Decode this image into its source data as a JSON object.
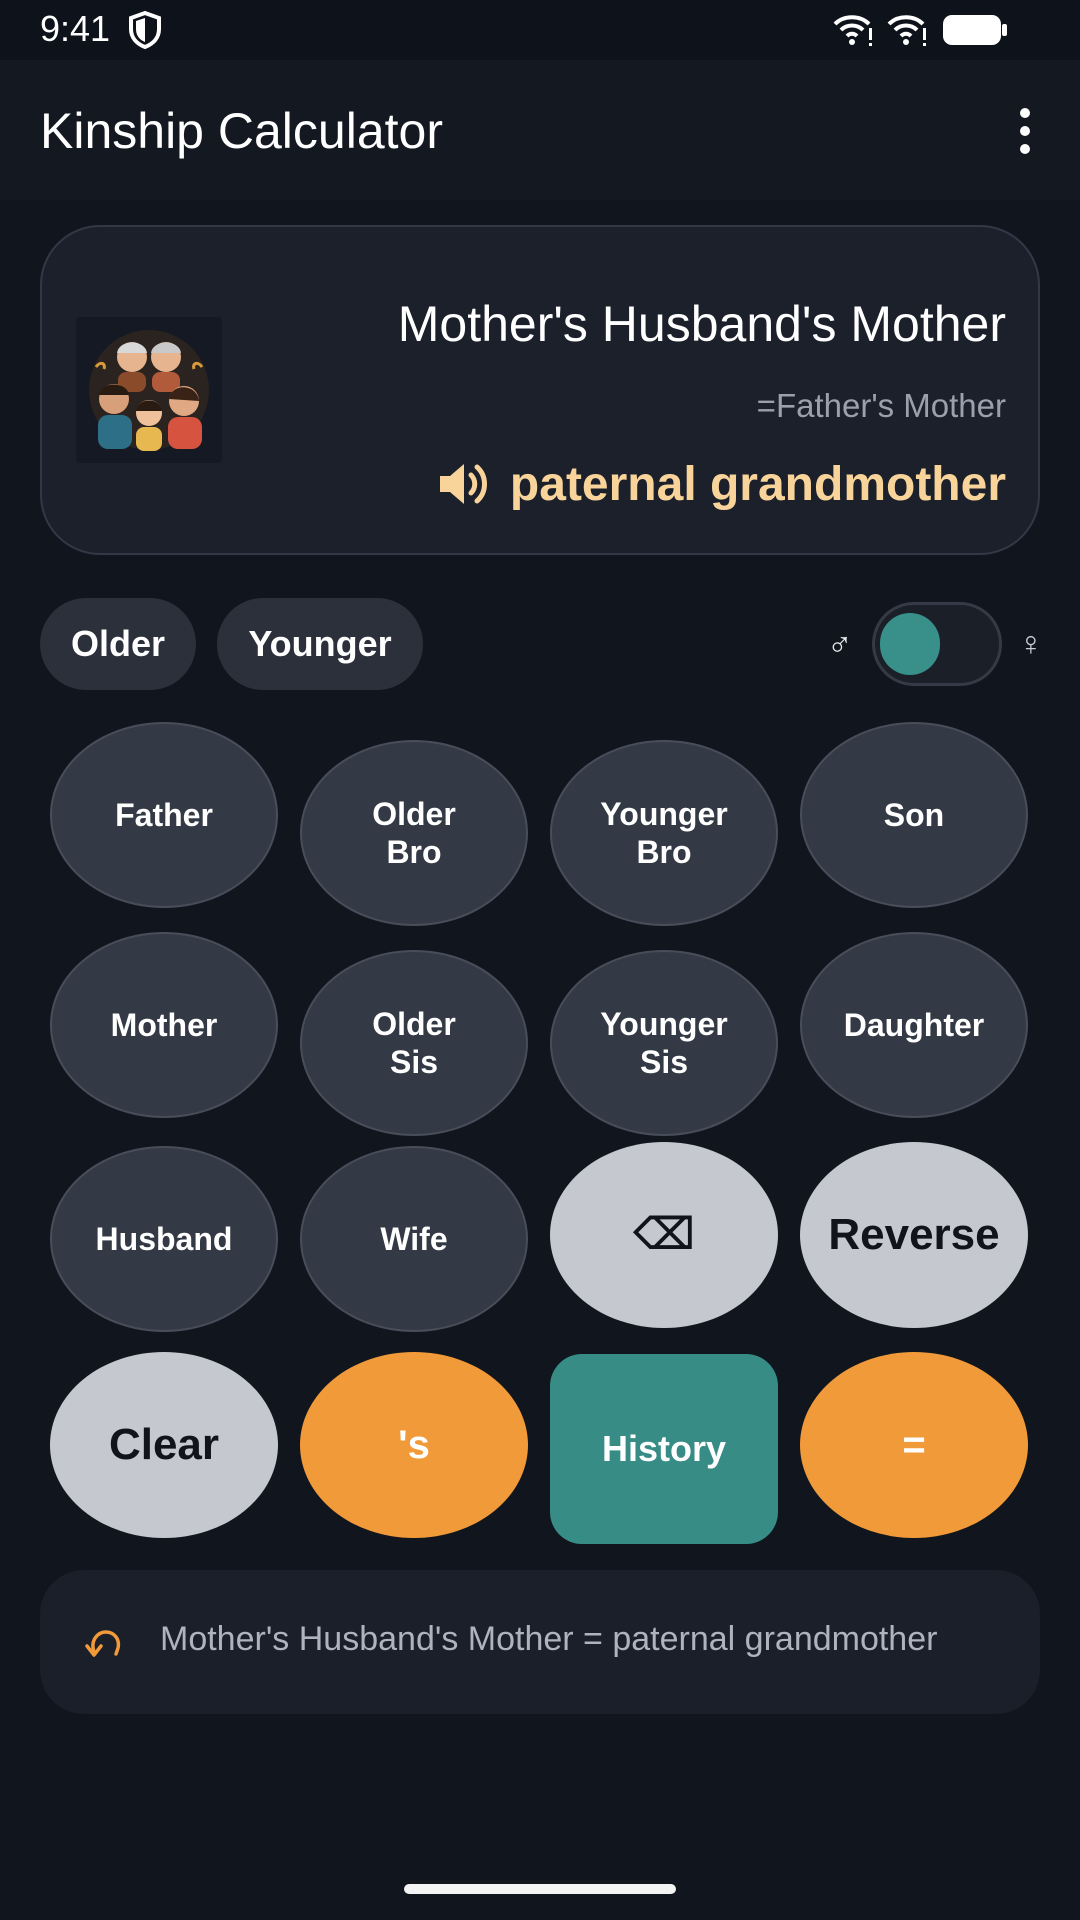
{
  "status_bar": {
    "time": "9:41",
    "icons": [
      "shield-icon",
      "wifi-icon",
      "wifi-icon",
      "battery-icon"
    ]
  },
  "app_bar": {
    "title": "Kinship Calculator",
    "menu_icon": "more-vert-icon"
  },
  "result": {
    "expression": "Mother's Husband's Mother",
    "equivalent": "=Father's Mother",
    "answer": "paternal grandmother",
    "speaker_icon": "speaker-icon",
    "avatar": "family-avatar-image"
  },
  "options": {
    "older_label": "Older",
    "younger_label": "Younger",
    "male_symbol": "♂",
    "female_symbol": "♀",
    "gender_toggle_on": false
  },
  "keypad": {
    "row1": [
      "Father",
      "Older\nBro",
      "Younger\nBro",
      "Son"
    ],
    "row2": [
      "Mother",
      "Older\nSis",
      "Younger\nSis",
      "Daughter"
    ],
    "row3": [
      "Husband",
      "Wife",
      "⌫",
      "Reverse"
    ],
    "row4": [
      "Clear",
      "'s",
      "History",
      "="
    ]
  },
  "colors": {
    "accent_orange": "#f19a3a",
    "accent_teal": "#378d86",
    "answer_gold": "#f9d49a",
    "background": "#11151d"
  },
  "history": {
    "icon": "undo-icon",
    "text": "Mother's Husband's Mother = paternal grandmother"
  }
}
